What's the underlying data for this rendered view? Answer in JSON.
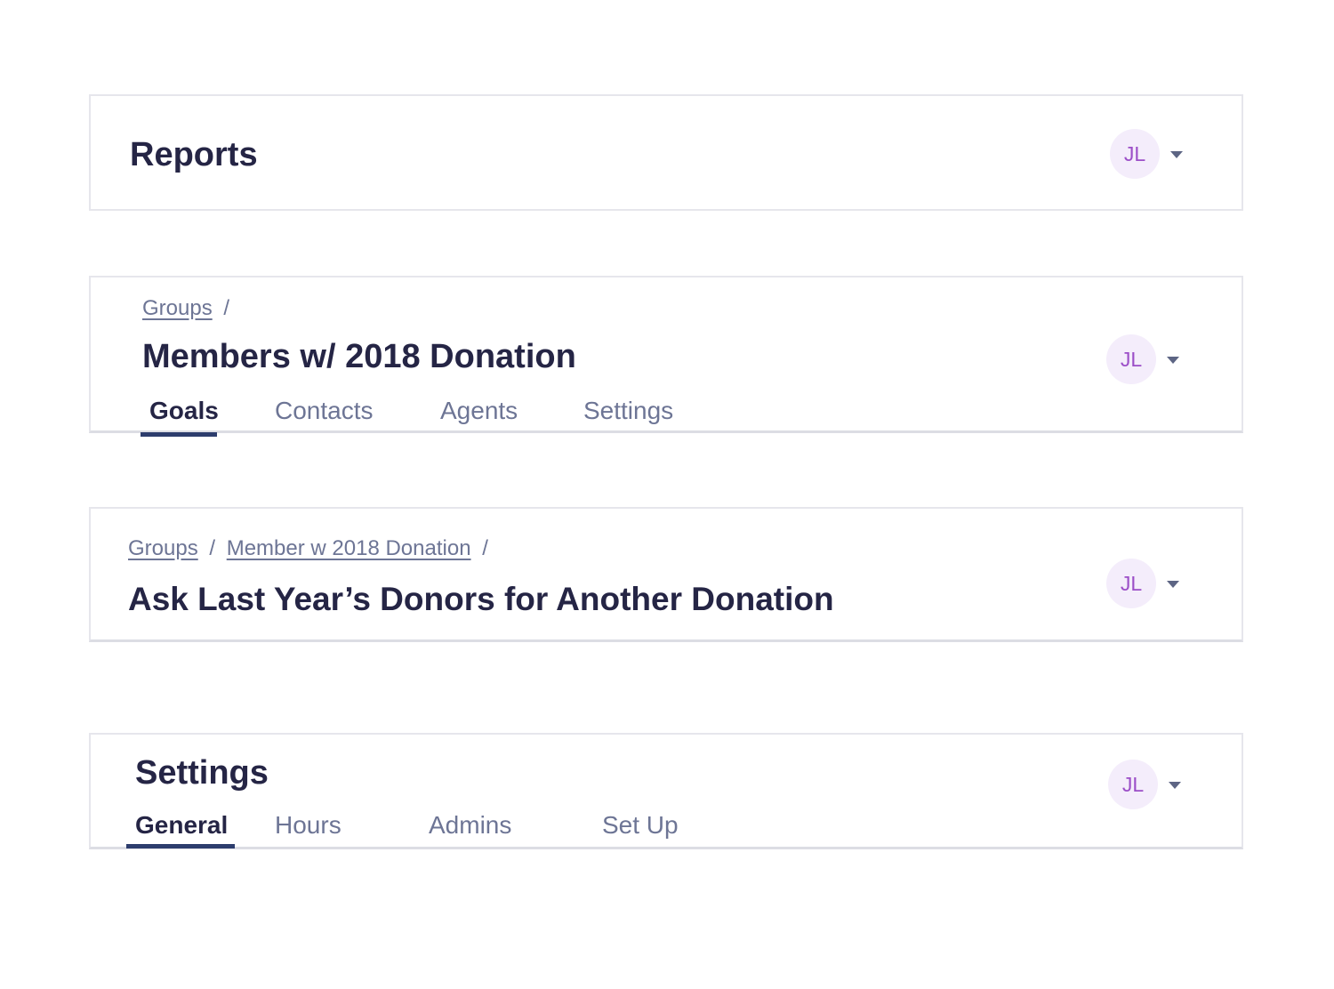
{
  "cards": [
    {
      "title": "Reports",
      "avatar": {
        "initials": "JL"
      }
    },
    {
      "breadcrumb": [
        {
          "label": "Groups"
        }
      ],
      "title": "Members w/ 2018 Donation",
      "avatar": {
        "initials": "JL"
      },
      "tabs": [
        {
          "label": "Goals",
          "active": true
        },
        {
          "label": "Contacts"
        },
        {
          "label": "Agents"
        },
        {
          "label": "Settings"
        }
      ]
    },
    {
      "breadcrumb": [
        {
          "label": "Groups"
        },
        {
          "label": "Member w 2018 Donation"
        }
      ],
      "title": "Ask Last Year’s Donors for Another Donation",
      "avatar": {
        "initials": "JL"
      }
    },
    {
      "title": "Settings",
      "avatar": {
        "initials": "JL"
      },
      "tabs": [
        {
          "label": "General",
          "active": true
        },
        {
          "label": "Hours"
        },
        {
          "label": "Admins"
        },
        {
          "label": "Set Up"
        }
      ]
    }
  ],
  "separator": "/",
  "colors": {
    "title": "#252545",
    "muted": "#6d7595",
    "avatar_bg": "#f4edfb",
    "avatar_text": "#9c4fc8",
    "active_tab_underline": "#2d3d6d",
    "border": "#e6e6ec"
  },
  "icons": {
    "dropdown": "caret-down-icon"
  }
}
